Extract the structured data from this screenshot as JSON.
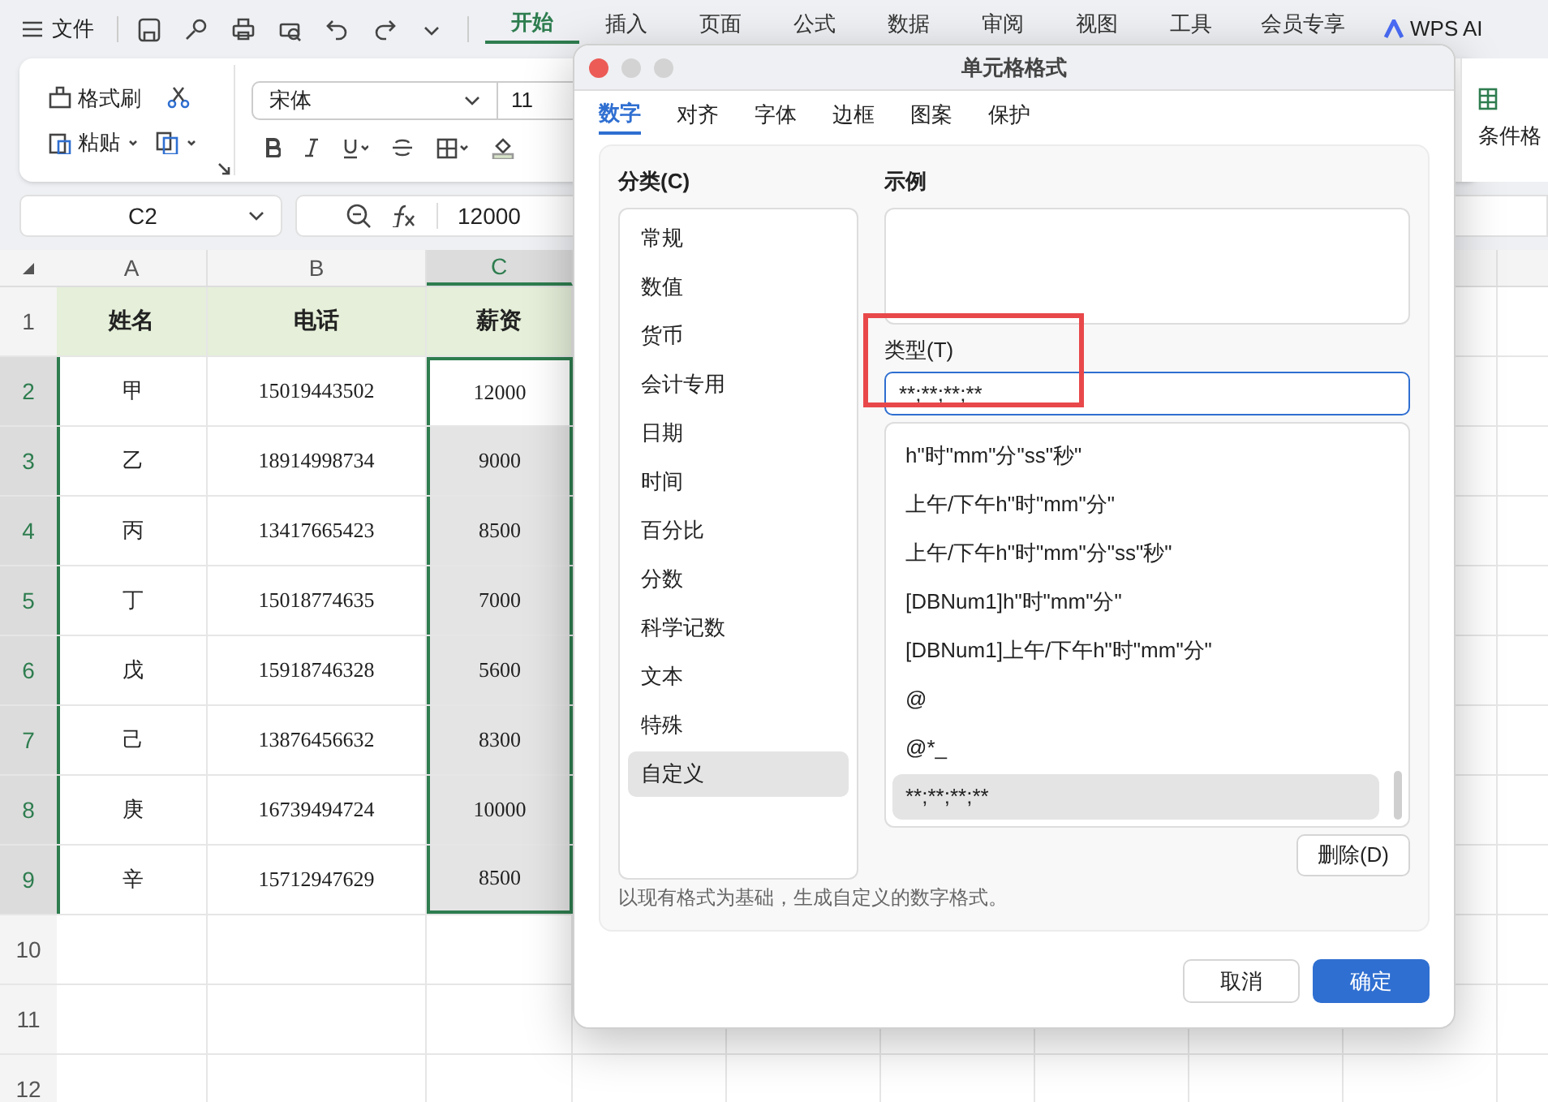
{
  "menu": {
    "file_label": "文件",
    "tabs": [
      {
        "label": "开始",
        "selected": true
      },
      {
        "label": "插入",
        "selected": false
      },
      {
        "label": "页面",
        "selected": false
      },
      {
        "label": "公式",
        "selected": false
      },
      {
        "label": "数据",
        "selected": false
      },
      {
        "label": "审阅",
        "selected": false
      },
      {
        "label": "视图",
        "selected": false
      },
      {
        "label": "工具",
        "selected": false
      },
      {
        "label": "会员专享",
        "selected": false
      }
    ],
    "ai_label": "WPS AI"
  },
  "ribbon": {
    "format_painter": "格式刷",
    "paste": "粘贴",
    "font_name": "宋体",
    "font_size": "11",
    "right_label": "条件格"
  },
  "formula_bar": {
    "cell_ref": "C2",
    "value": "12000"
  },
  "sheet": {
    "columns": [
      {
        "label": "A",
        "selected": false
      },
      {
        "label": "B",
        "selected": false
      },
      {
        "label": "C",
        "selected": true
      }
    ],
    "rows": [
      {
        "number": "1",
        "kind": "header",
        "selected": false,
        "cells": [
          "姓名",
          "电话",
          "薪资"
        ]
      },
      {
        "number": "2",
        "kind": "data",
        "selected": true,
        "cells": [
          "甲",
          "15019443502",
          "12000"
        ]
      },
      {
        "number": "3",
        "kind": "data",
        "selected": true,
        "cells": [
          "乙",
          "18914998734",
          "9000"
        ]
      },
      {
        "number": "4",
        "kind": "data",
        "selected": true,
        "cells": [
          "丙",
          "13417665423",
          "8500"
        ]
      },
      {
        "number": "5",
        "kind": "data",
        "selected": true,
        "cells": [
          "丁",
          "15018774635",
          "7000"
        ]
      },
      {
        "number": "6",
        "kind": "data",
        "selected": true,
        "cells": [
          "戊",
          "15918746328",
          "5600"
        ]
      },
      {
        "number": "7",
        "kind": "data",
        "selected": true,
        "cells": [
          "己",
          "13876456632",
          "8300"
        ]
      },
      {
        "number": "8",
        "kind": "data",
        "selected": true,
        "cells": [
          "庚",
          "16739494724",
          "10000"
        ]
      },
      {
        "number": "9",
        "kind": "data",
        "selected": true,
        "cells": [
          "辛",
          "15712947629",
          "8500"
        ]
      },
      {
        "number": "10",
        "kind": "empty",
        "selected": false
      },
      {
        "number": "11",
        "kind": "empty",
        "selected": false
      },
      {
        "number": "12",
        "kind": "empty",
        "selected": false
      }
    ]
  },
  "dialog": {
    "title": "单元格格式",
    "tabs": [
      {
        "label": "数字",
        "selected": true
      },
      {
        "label": "对齐",
        "selected": false
      },
      {
        "label": "字体",
        "selected": false
      },
      {
        "label": "边框",
        "selected": false
      },
      {
        "label": "图案",
        "selected": false
      },
      {
        "label": "保护",
        "selected": false
      }
    ],
    "category_label": "分类(C)",
    "categories": [
      {
        "label": "常规",
        "selected": false
      },
      {
        "label": "数值",
        "selected": false
      },
      {
        "label": "货币",
        "selected": false
      },
      {
        "label": "会计专用",
        "selected": false
      },
      {
        "label": "日期",
        "selected": false
      },
      {
        "label": "时间",
        "selected": false
      },
      {
        "label": "百分比",
        "selected": false
      },
      {
        "label": "分数",
        "selected": false
      },
      {
        "label": "科学记数",
        "selected": false
      },
      {
        "label": "文本",
        "selected": false
      },
      {
        "label": "特殊",
        "selected": false
      },
      {
        "label": "自定义",
        "selected": true
      }
    ],
    "sample_label": "示例",
    "type_label": "类型(T)",
    "type_value": "**;**;**;**",
    "formats": [
      {
        "label": "h\"时\"mm\"分\"ss\"秒\"",
        "selected": false
      },
      {
        "label": "上午/下午h\"时\"mm\"分\"",
        "selected": false
      },
      {
        "label": "上午/下午h\"时\"mm\"分\"ss\"秒\"",
        "selected": false
      },
      {
        "label": "[DBNum1]h\"时\"mm\"分\"",
        "selected": false
      },
      {
        "label": "[DBNum1]上午/下午h\"时\"mm\"分\"",
        "selected": false
      },
      {
        "label": "@",
        "selected": false
      },
      {
        "label": "@*_",
        "selected": false
      },
      {
        "label": "**;**;**;**",
        "selected": true
      }
    ],
    "delete_button": "删除(D)",
    "hint": "以现有格式为基础，生成自定义的数字格式。",
    "buttons": [
      {
        "label": "取消",
        "kind": "secondary"
      },
      {
        "label": "确定",
        "kind": "primary"
      }
    ]
  }
}
